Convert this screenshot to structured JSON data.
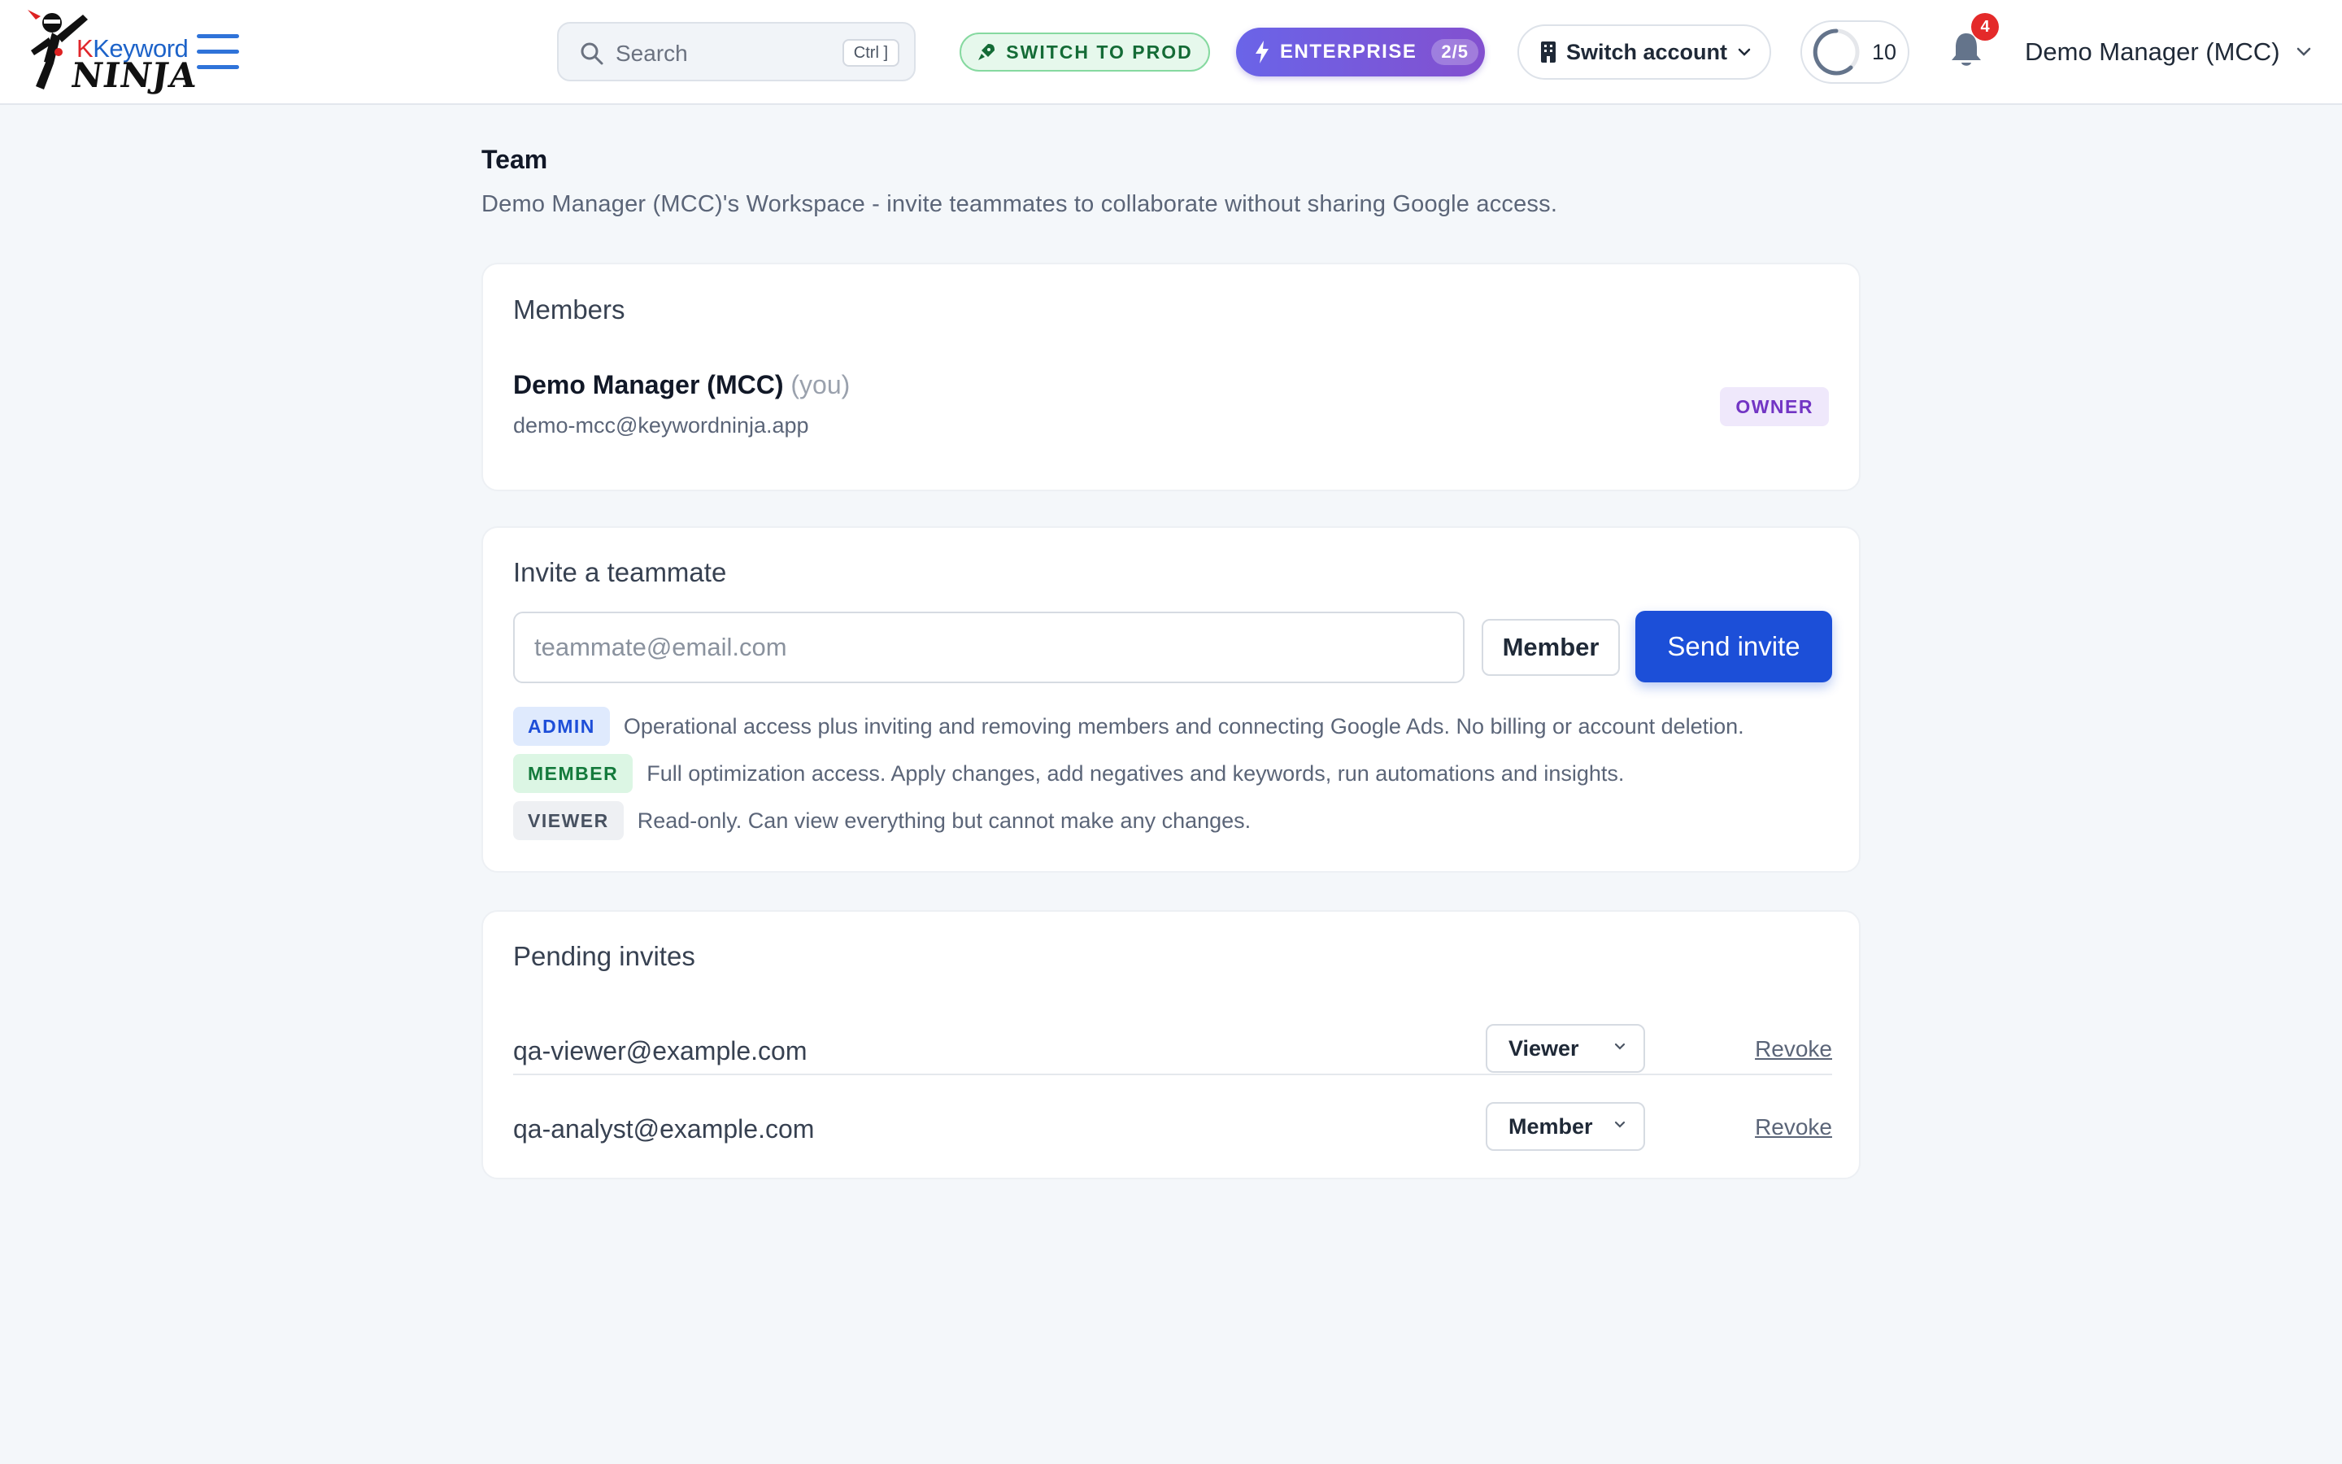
{
  "header": {
    "logo_text_top": "Keyword",
    "logo_text_bottom": "NINJA",
    "search_placeholder": "Search",
    "search_shortcut": "Ctrl ]",
    "switch_to_prod_label": "SWITCH TO PROD",
    "plan_label": "ENTERPRISE",
    "plan_usage": "2/5",
    "switch_account_label": "Switch account",
    "credits_count": "10",
    "notifications_count": "4",
    "user_name": "Demo Manager (MCC)",
    "colors": {
      "accent": "#1c4fd8",
      "prod_green": "#146b36",
      "enterprise_purple": "#7a55d6"
    }
  },
  "page": {
    "title": "Team",
    "subtitle": "Demo Manager (MCC)'s Workspace - invite teammates to collaborate without sharing Google access."
  },
  "members": {
    "title": "Members",
    "items": [
      {
        "name": "Demo Manager (MCC)",
        "you_label": "(you)",
        "email": "demo-mcc@keywordninja.app",
        "role": "OWNER"
      }
    ]
  },
  "invite": {
    "title": "Invite a teammate",
    "email_placeholder": "teammate@email.com",
    "role_selected": "Member",
    "send_label": "Send invite",
    "roles": [
      {
        "tag": "ADMIN",
        "description": "Operational access plus inviting and removing members and connecting Google Ads. No billing or account deletion."
      },
      {
        "tag": "MEMBER",
        "description": "Full optimization access. Apply changes, add negatives and keywords, run automations and insights."
      },
      {
        "tag": "VIEWER",
        "description": "Read-only. Can view everything but cannot make any changes."
      }
    ]
  },
  "pending": {
    "title": "Pending invites",
    "revoke_label": "Revoke",
    "items": [
      {
        "email": "qa-viewer@example.com",
        "role": "Viewer"
      },
      {
        "email": "qa-analyst@example.com",
        "role": "Member"
      }
    ]
  }
}
